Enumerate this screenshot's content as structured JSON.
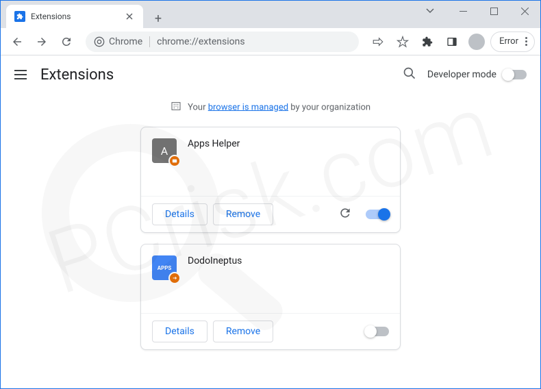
{
  "window": {
    "tab_title": "Extensions"
  },
  "omnibox": {
    "prefix": "Chrome",
    "url": "chrome://extensions"
  },
  "toolbar": {
    "error_label": "Error"
  },
  "page": {
    "title": "Extensions",
    "developer_mode_label": "Developer mode"
  },
  "banner": {
    "prefix": "Your ",
    "link": "browser is managed",
    "suffix": " by your organization"
  },
  "buttons": {
    "details": "Details",
    "remove": "Remove"
  },
  "extensions": [
    {
      "name": "Apps Helper",
      "icon_letter": "A",
      "icon_style": "grey",
      "enabled": true,
      "show_reload": true
    },
    {
      "name": "DodoIneptus",
      "icon_letter": "APPS",
      "icon_style": "blue",
      "enabled": false,
      "show_reload": false
    }
  ],
  "watermark": "PCrisk.com"
}
